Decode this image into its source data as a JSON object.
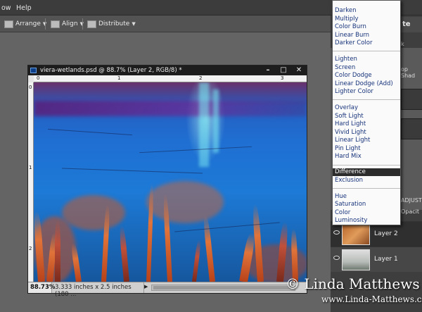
{
  "menubar": {
    "items": [
      "ow",
      "Help"
    ]
  },
  "toolbar": {
    "arrange_label": "Arrange",
    "align_label": "Align",
    "distribute_label": "Distribute"
  },
  "right_panel": {
    "button_label": "te",
    "tab_label": "k",
    "tab_label_2": "op Shad",
    "adjust_label": "ADJUSTM",
    "opacity_label": "Opacit"
  },
  "layers": [
    {
      "name": "Layer 2"
    },
    {
      "name": "Layer 1"
    }
  ],
  "document": {
    "title": "viera-wetlands.psd @ 88.7% (Layer 2, RGB/8) *",
    "zoom": "88.73%",
    "status": "3.333 inches x 2.5 inches (180 ...",
    "ruler_top": [
      "0",
      "1",
      "2",
      "3"
    ],
    "ruler_left": [
      "0",
      "1",
      "2"
    ]
  },
  "blend_menu": {
    "group1": [
      "Darken",
      "Multiply",
      "Color Burn",
      "Linear Burn",
      "Darker Color"
    ],
    "group2": [
      "Lighten",
      "Screen",
      "Color Dodge",
      "Linear Dodge (Add)",
      "Lighter Color"
    ],
    "group3": [
      "Overlay",
      "Soft Light",
      "Hard Light",
      "Vivid Light",
      "Linear Light",
      "Pin Light",
      "Hard Mix"
    ],
    "group4": [
      "Difference",
      "Exclusion"
    ],
    "group5": [
      "Hue",
      "Saturation",
      "Color",
      "Luminosity"
    ],
    "selected": "Difference"
  },
  "watermark": {
    "text": "© Linda Matthews",
    "url": "www.Linda-Matthews.com"
  },
  "colors": {
    "menu_text": "#16327a",
    "highlight_bg": "#2c2c2c",
    "canvas_blue": "#1d7ad6",
    "canvas_orange": "#e0743a"
  }
}
